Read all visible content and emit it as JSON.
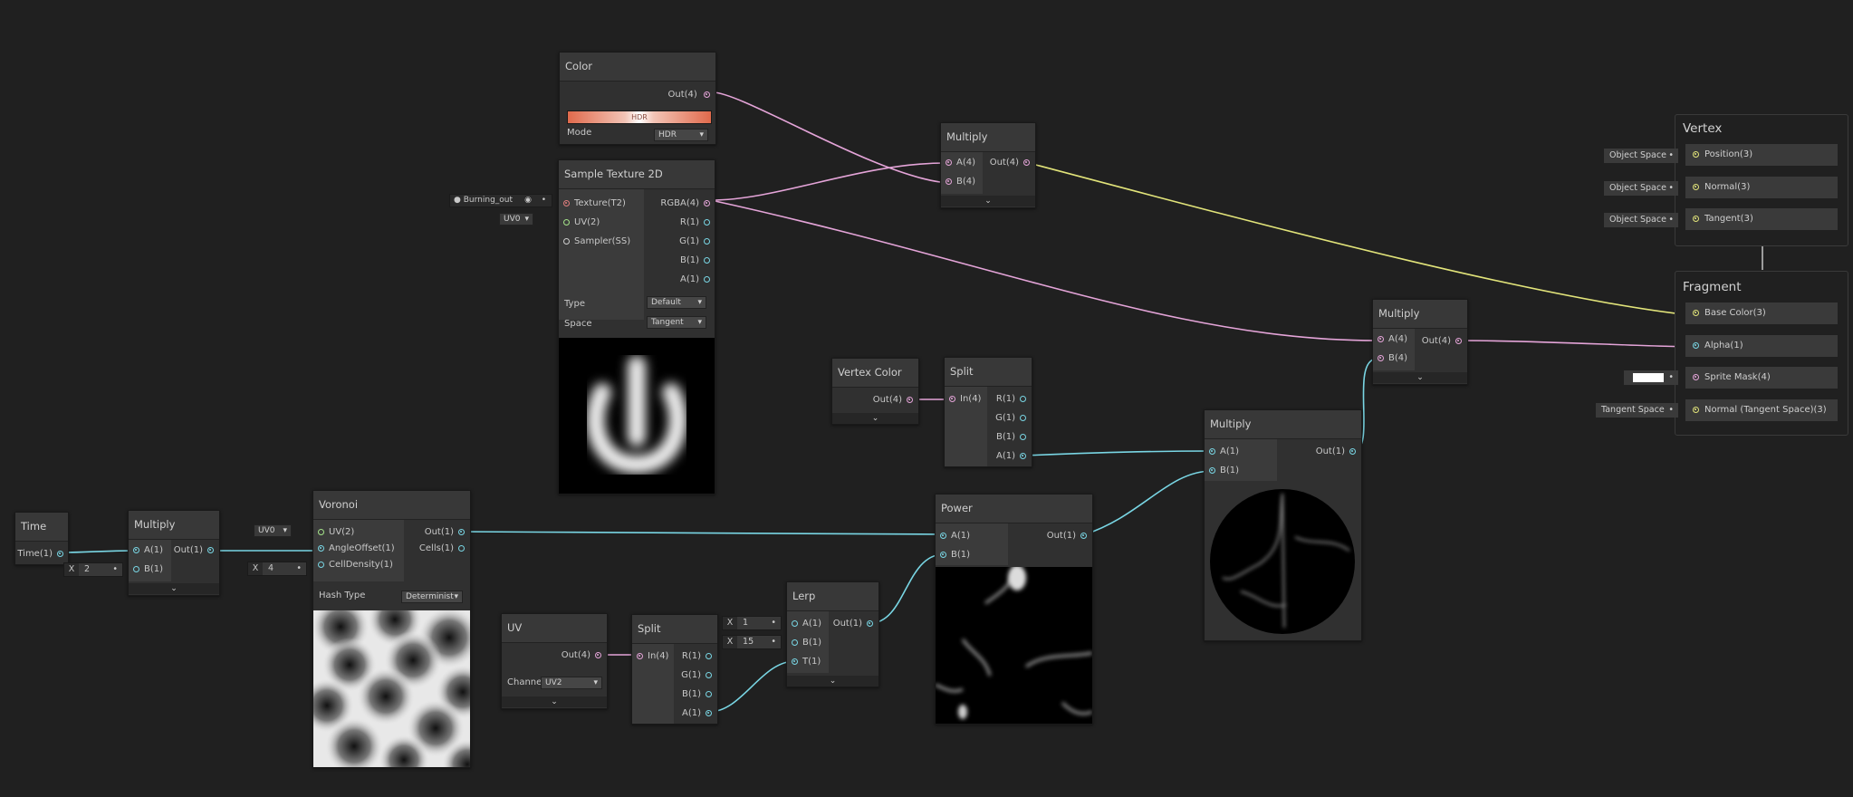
{
  "colors": {
    "background": "#202020",
    "node": "#303030",
    "wire_pink": "#e4a4d8",
    "wire_cyan": "#79d6e4",
    "wire_yellow": "#e2e47a"
  },
  "color_node": {
    "title": "Color",
    "out": "Out(4)",
    "hdr_label": "HDR",
    "mode_label": "Mode",
    "mode_value": "HDR"
  },
  "sample_texture": {
    "title": "Sample Texture 2D",
    "texture_field": "Burning_out",
    "uv_field": "UV0",
    "inputs": [
      "Texture(T2)",
      "UV(2)",
      "Sampler(SS)"
    ],
    "outputs": [
      "RGBA(4)",
      "R(1)",
      "G(1)",
      "B(1)",
      "A(1)"
    ],
    "type_label": "Type",
    "type_value": "Default",
    "space_label": "Space",
    "space_value": "Tangent"
  },
  "multiply_top": {
    "title": "Multiply",
    "inputs": [
      "A(4)",
      "B(4)"
    ],
    "out": "Out(4)"
  },
  "multiply_right": {
    "title": "Multiply",
    "inputs": [
      "A(4)",
      "B(4)"
    ],
    "out": "Out(4)"
  },
  "vertex_color": {
    "title": "Vertex Color",
    "out": "Out(4)"
  },
  "split_top": {
    "title": "Split",
    "in": "In(4)",
    "outputs": [
      "R(1)",
      "G(1)",
      "B(1)",
      "A(1)"
    ]
  },
  "multiply_mid": {
    "title": "Multiply",
    "inputs": [
      "A(1)",
      "B(1)"
    ],
    "out": "Out(1)"
  },
  "time": {
    "title": "Time",
    "out": "Time(1)"
  },
  "multiply_left": {
    "title": "Multiply",
    "inputs": [
      "A(1)",
      "B(1)"
    ],
    "out": "Out(1)",
    "b_axis": "X",
    "b_value": "2"
  },
  "voronoi": {
    "title": "Voronoi",
    "inputs": [
      "UV(2)",
      "AngleOffset(1)",
      "CellDensity(1)"
    ],
    "outputs": [
      "Out(1)",
      "Cells(1)"
    ],
    "uv_field": "UV0",
    "density_axis": "X",
    "density_value": "4",
    "hash_label": "Hash Type",
    "hash_value": "Determinist"
  },
  "uv_node": {
    "title": "UV",
    "out": "Out(4)",
    "channel_label": "Channe",
    "channel_value": "UV2"
  },
  "split_bottom": {
    "title": "Split",
    "in": "In(4)",
    "outputs": [
      "R(1)",
      "G(1)",
      "B(1)",
      "A(1)"
    ]
  },
  "lerp": {
    "title": "Lerp",
    "inputs": [
      "A(1)",
      "B(1)",
      "T(1)"
    ],
    "out": "Out(1)",
    "a_axis": "X",
    "a_value": "1",
    "b_axis": "X",
    "b_value": "15"
  },
  "power": {
    "title": "Power",
    "inputs": [
      "A(1)",
      "B(1)"
    ],
    "out": "Out(1)"
  },
  "vertex_stack": {
    "title": "Vertex",
    "slots": [
      "Position(3)",
      "Normal(3)",
      "Tangent(3)"
    ],
    "spaces": [
      "Object Space",
      "Object Space",
      "Object Space"
    ]
  },
  "fragment_stack": {
    "title": "Fragment",
    "slots": [
      "Base Color(3)",
      "Alpha(1)",
      "Sprite Mask(4)",
      "Normal (Tangent Space)(3)"
    ],
    "normal_space": "Tangent Space"
  }
}
